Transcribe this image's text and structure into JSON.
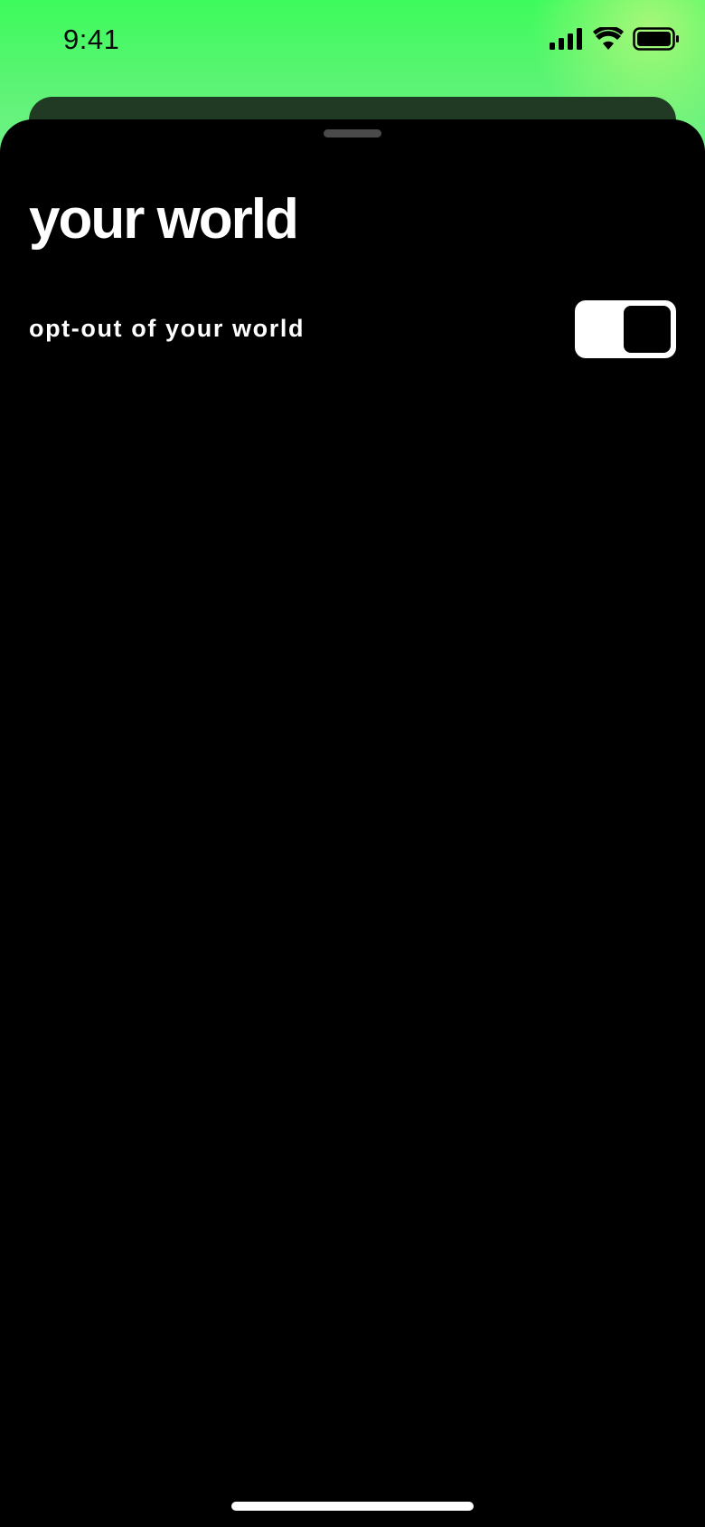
{
  "status_bar": {
    "time": "9:41",
    "icons": [
      "cellular-signal-icon",
      "wifi-icon",
      "battery-icon"
    ]
  },
  "sheet": {
    "title": "your world",
    "setting": {
      "label": "opt-out of your world",
      "toggle_on": true
    }
  },
  "colors": {
    "background_top": "#3dfb5c",
    "sheet": "#000000",
    "toggle_track": "#ffffff",
    "toggle_knob": "#000000",
    "text": "#ffffff"
  }
}
